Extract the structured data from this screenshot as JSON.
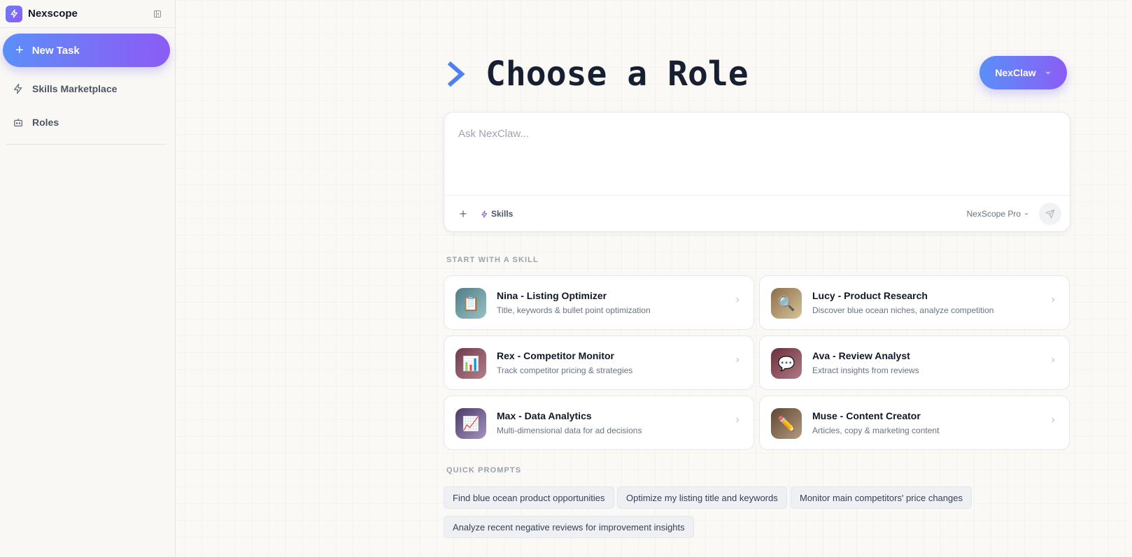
{
  "colors": {
    "accent_start": "#5b8ff8",
    "accent_end": "#8b5cf6",
    "title": "#162032"
  },
  "sidebar": {
    "brand_name": "Nexscope",
    "brand_icon": "lightning-icon",
    "collapse_icon": "sidebar-collapse-icon",
    "new_task_label": "New Task",
    "items": [
      {
        "label": "Skills Marketplace",
        "icon": "lightning-icon"
      },
      {
        "label": "Roles",
        "icon": "robot-icon"
      }
    ]
  },
  "main": {
    "title": "Choose a Role",
    "model_button": "NexClaw",
    "composer": {
      "placeholder": "Ask NexClaw...",
      "skills_label": "Skills",
      "model_select": "NexScope Pro"
    },
    "skills_section_label": "START WITH A SKILL",
    "skills": [
      {
        "name": "Nina - Listing Optimizer",
        "desc": "Title, keywords & bullet point optimization",
        "icon": "📋",
        "color_from": "#4e7d86",
        "color_to": "#9ac2c6"
      },
      {
        "name": "Lucy - Product Research",
        "desc": "Discover blue ocean niches, analyze competition",
        "icon": "🔍",
        "color_from": "#8a6d4a",
        "color_to": "#d8c39a"
      },
      {
        "name": "Rex - Competitor Monitor",
        "desc": "Track competitor pricing & strategies",
        "icon": "📊",
        "color_from": "#6e3a4a",
        "color_to": "#b5808c"
      },
      {
        "name": "Ava - Review Analyst",
        "desc": "Extract insights from reviews",
        "icon": "💬",
        "color_from": "#6a2f3c",
        "color_to": "#b07a84"
      },
      {
        "name": "Max - Data Analytics",
        "desc": "Multi-dimensional data for ad decisions",
        "icon": "📈",
        "color_from": "#4b3a66",
        "color_to": "#a493c0"
      },
      {
        "name": "Muse - Content Creator",
        "desc": "Articles, copy & marketing content",
        "icon": "✏️",
        "color_from": "#5e4632",
        "color_to": "#b39a7e"
      }
    ],
    "prompts_section_label": "QUICK PROMPTS",
    "quick_prompts": [
      "Find blue ocean product opportunities",
      "Optimize my listing title and keywords",
      "Monitor main competitors' price changes",
      "Analyze recent negative reviews for improvement insights"
    ]
  }
}
